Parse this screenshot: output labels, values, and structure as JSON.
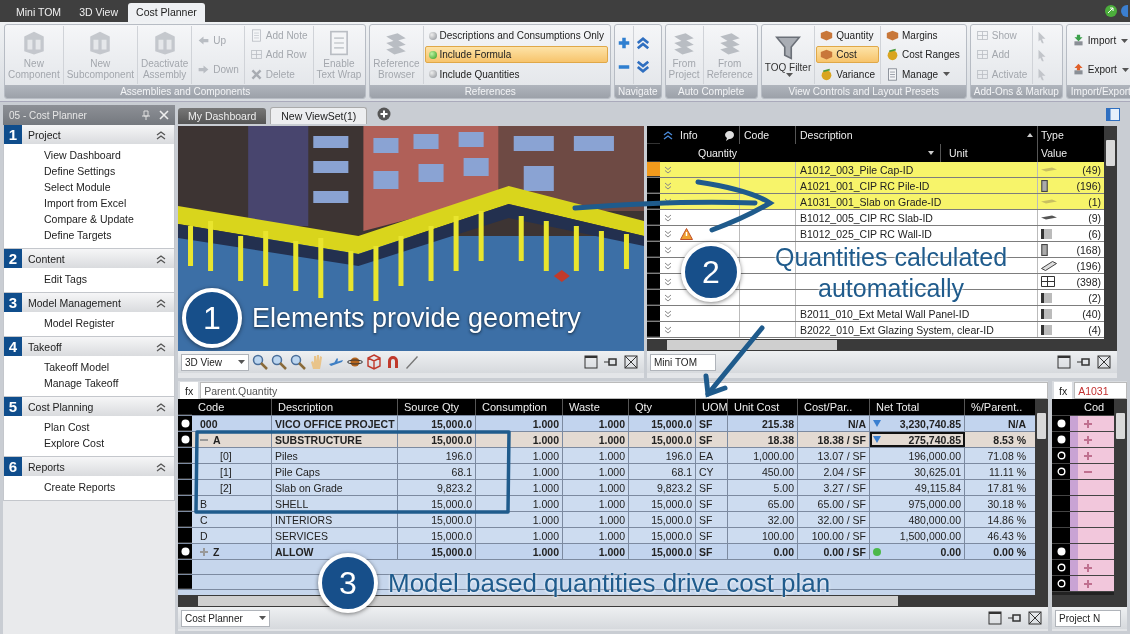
{
  "app_tabs": [
    {
      "label": "Mini TOM",
      "selected": false
    },
    {
      "label": "3D View",
      "selected": false
    },
    {
      "label": "Cost Planner",
      "selected": true
    }
  ],
  "ribbon": {
    "groups": [
      {
        "title": "Assemblies and Components",
        "columns": [
          [
            {
              "label": "New Component",
              "kind": "large",
              "disabled": true
            }
          ],
          [
            {
              "label": "New Subcomponent",
              "kind": "large",
              "disabled": true
            }
          ],
          [
            {
              "label": "Deactivate Assembly",
              "kind": "large",
              "disabled": true
            }
          ],
          [
            {
              "label": "Up",
              "kind": "small",
              "disabled": true
            },
            {
              "label": "Down",
              "kind": "small",
              "disabled": true
            }
          ],
          [
            {
              "label": "Add Note",
              "kind": "small",
              "disabled": true
            },
            {
              "label": "Add Row",
              "kind": "small",
              "disabled": true
            },
            {
              "label": "Delete",
              "kind": "small",
              "disabled": true
            }
          ],
          [
            {
              "label": "Enable Text Wrap",
              "kind": "large",
              "disabled": true
            }
          ]
        ]
      },
      {
        "title": "References",
        "columns": [
          [
            {
              "label": "Reference Browser",
              "kind": "large",
              "disabled": true
            }
          ],
          [
            {
              "label": "Descriptions and Consumptions Only",
              "kind": "radio",
              "selected": false
            },
            {
              "label": "Include Formula",
              "kind": "radio",
              "selected": true
            },
            {
              "label": "Include Quantities",
              "kind": "radio",
              "selected": false
            }
          ]
        ]
      },
      {
        "title": "Navigate",
        "columns": [
          [
            {
              "kind": "icon"
            },
            {
              "kind": "icon"
            }
          ],
          [
            {
              "kind": "icon"
            },
            {
              "kind": "icon"
            }
          ]
        ]
      },
      {
        "title": "Auto Complete",
        "columns": [
          [
            {
              "label": "From Project",
              "kind": "large",
              "disabled": true
            }
          ],
          [
            {
              "label": "From Reference",
              "kind": "large",
              "disabled": true
            }
          ]
        ]
      },
      {
        "title": "View Controls and Layout Presets",
        "columns": [
          [
            {
              "label": "TOQ Filter",
              "kind": "large_dropdown",
              "disabled": false
            }
          ],
          [
            {
              "label": "Quantity",
              "kind": "toggle",
              "selected": false
            },
            {
              "label": "Cost",
              "kind": "toggle",
              "selected": true
            },
            {
              "label": "Variance",
              "kind": "toggle",
              "selected": false
            }
          ],
          [
            {
              "label": "Margins",
              "kind": "small",
              "disabled": false
            },
            {
              "label": "Cost Ranges",
              "kind": "small",
              "disabled": false
            },
            {
              "label": "Manage",
              "kind": "dropdown",
              "disabled": false
            }
          ]
        ]
      },
      {
        "title": "Add-Ons & Markup",
        "columns": [
          [
            {
              "label": "Show",
              "kind": "small",
              "disabled": true
            },
            {
              "label": "Add",
              "kind": "small",
              "disabled": true
            },
            {
              "label": "Activate",
              "kind": "small",
              "disabled": true
            }
          ],
          [
            {
              "kind": "icon",
              "disabled": true
            },
            {
              "kind": "icon",
              "disabled": true
            },
            {
              "kind": "icon",
              "disabled": true
            }
          ]
        ]
      },
      {
        "title": "Import/Export",
        "columns": [
          [
            {
              "label": "Import",
              "kind": "dropdown",
              "disabled": false
            },
            {
              "label": "Export",
              "kind": "dropdown",
              "disabled": false
            }
          ]
        ]
      }
    ]
  },
  "sidebar": {
    "title": "05 - Cost Planner",
    "sections": [
      {
        "number": "1",
        "title": "Project",
        "expanded": true,
        "items": [
          "View Dashboard",
          "Define Settings",
          "Select Module",
          "Import from Excel",
          "Compare & Update",
          "Define Targets"
        ]
      },
      {
        "number": "2",
        "title": "Content",
        "expanded": true,
        "items": [
          "Edit Tags"
        ]
      },
      {
        "number": "3",
        "title": "Model Management",
        "expanded": true,
        "items": [
          "Model Register"
        ]
      },
      {
        "number": "4",
        "title": "Takeoff",
        "expanded": true,
        "items": [
          "Takeoff Model",
          "Manage Takeoff"
        ]
      },
      {
        "number": "5",
        "title": "Cost Planning",
        "expanded": true,
        "items": [
          "Plan Cost",
          "Explore Cost"
        ]
      },
      {
        "number": "6",
        "title": "Reports",
        "expanded": true,
        "items": [
          "Create Reports"
        ]
      }
    ]
  },
  "view_tabs": [
    {
      "label": "My Dashboard",
      "selected": false
    },
    {
      "label": "New ViewSet(1)",
      "selected": true
    }
  ],
  "model_view": {
    "callout": {
      "number": "1",
      "text": "Elements provide geometry"
    },
    "view_select": "3D View"
  },
  "quantity_table": {
    "columns": [
      "Info",
      "Code",
      "Description",
      "Type"
    ],
    "subcolumns": [
      "Quantity",
      "Unit",
      "Value"
    ],
    "rows": [
      {
        "description": "A1012_003_Pile Cap-ID",
        "value": "(49)",
        "highlighted": true,
        "selected": true,
        "warning": false
      },
      {
        "description": "A1021_001_CIP RC Pile-ID",
        "value": "(196)",
        "highlighted": true,
        "selected": false,
        "warning": false
      },
      {
        "description": "A1031_001_Slab on Grade-ID",
        "value": "(1)",
        "highlighted": true,
        "selected": false,
        "warning": false
      },
      {
        "description": "B1012_005_CIP RC Slab-ID",
        "value": "(9)",
        "highlighted": false,
        "selected": false,
        "warning": false
      },
      {
        "description": "B1012_025_CIP RC Wall-ID",
        "value": "(6)",
        "highlighted": false,
        "selected": false,
        "warning": true
      },
      {
        "value": "(168)",
        "highlighted": false,
        "selected": false,
        "warning": false
      },
      {
        "value": "(196)",
        "highlighted": false,
        "selected": false,
        "warning": false
      },
      {
        "value": "(398)",
        "highlighted": false,
        "selected": false,
        "warning": false
      },
      {
        "value": "(2)",
        "highlighted": false,
        "selected": false,
        "warning": false
      },
      {
        "description": "B2011_010_Ext Metal Wall Panel-ID",
        "value": "(40)",
        "highlighted": false,
        "selected": false,
        "warning": false
      },
      {
        "description": "B2022_010_Ext Glazing System, clear-ID",
        "value": "(4)",
        "highlighted": false,
        "selected": false,
        "warning": false
      }
    ],
    "callout": {
      "number": "2",
      "text": "Quantities calculated automatically"
    },
    "view_select": "Mini TOM"
  },
  "cost_table": {
    "formula_label": "fx",
    "formula": "Parent.Quantity",
    "columns": [
      "Code",
      "Description",
      "Source Qty",
      "Consumption",
      "Waste",
      "Qty",
      "UOM",
      "Unit Cost",
      "Cost/Par..",
      "Net Total",
      "%/Parent.."
    ],
    "rows": [
      {
        "code": "000",
        "description": "VICO OFFICE PROJECT",
        "source_qty": "15,000.0",
        "consumption": "1.000",
        "waste": "1.000",
        "qty": "15,000.0",
        "uom": "SF",
        "unit_cost": "215.38",
        "cost_per_parent": "N/A",
        "net_total": "3,230,740.85",
        "pct_parent": "N/A",
        "bullet": true,
        "bold": true,
        "selected": false,
        "down_marker": true,
        "status_dot": false
      },
      {
        "code": "A",
        "description": "SUBSTRUCTURE",
        "source_qty": "15,000.0",
        "consumption": "1.000",
        "waste": "1.000",
        "qty": "15,000.0",
        "uom": "SF",
        "unit_cost": "18.38",
        "cost_per_parent": "18.38 / SF",
        "net_total": "275,740.85",
        "pct_parent": "8.53 %",
        "bullet": true,
        "bold": true,
        "selected": true,
        "down_marker": true,
        "status_dot": false,
        "expanded": true,
        "children": [
          {
            "code": "[0]",
            "description": "Piles",
            "source_qty": "196.0",
            "consumption": "1.000",
            "waste": "1.000",
            "qty": "196.0",
            "uom": "EA",
            "unit_cost": "1,000.00",
            "cost_per_parent": "13.07 / SF",
            "net_total": "196,000.00",
            "pct_parent": "71.08 %",
            "bullet": false,
            "bold": false,
            "selected": false,
            "down_marker": false,
            "status_dot": false
          },
          {
            "code": "[1]",
            "description": "Pile Caps",
            "source_qty": "68.1",
            "consumption": "1.000",
            "waste": "1.000",
            "qty": "68.1",
            "uom": "CY",
            "unit_cost": "450.00",
            "cost_per_parent": "2.04 / SF",
            "net_total": "30,625.01",
            "pct_parent": "11.11 %",
            "bullet": false,
            "bold": false,
            "selected": false,
            "down_marker": false,
            "status_dot": false
          },
          {
            "code": "[2]",
            "description": "Slab on Grade",
            "source_qty": "9,823.2",
            "consumption": "1.000",
            "waste": "1.000",
            "qty": "9,823.2",
            "uom": "SF",
            "unit_cost": "5.00",
            "cost_per_parent": "3.27 / SF",
            "net_total": "49,115.84",
            "pct_parent": "17.81 %",
            "bullet": false,
            "bold": false,
            "selected": false,
            "down_marker": false,
            "status_dot": false
          }
        ]
      },
      {
        "code": "B",
        "description": "SHELL",
        "source_qty": "15,000.0",
        "consumption": "1.000",
        "waste": "1.000",
        "qty": "15,000.0",
        "uom": "SF",
        "unit_cost": "65.00",
        "cost_per_parent": "65.00 / SF",
        "net_total": "975,000.00",
        "pct_parent": "30.18 %",
        "bullet": false,
        "bold": false,
        "selected": false,
        "down_marker": false,
        "status_dot": false
      },
      {
        "code": "C",
        "description": "INTERIORS",
        "source_qty": "15,000.0",
        "consumption": "1.000",
        "waste": "1.000",
        "qty": "15,000.0",
        "uom": "SF",
        "unit_cost": "32.00",
        "cost_per_parent": "32.00 / SF",
        "net_total": "480,000.00",
        "pct_parent": "14.86 %",
        "bullet": false,
        "bold": false,
        "selected": false,
        "down_marker": false,
        "status_dot": false
      },
      {
        "code": "D",
        "description": "SERVICES",
        "source_qty": "15,000.0",
        "consumption": "1.000",
        "waste": "1.000",
        "qty": "15,000.0",
        "uom": "SF",
        "unit_cost": "100.00",
        "cost_per_parent": "100.00 / SF",
        "net_total": "1,500,000.00",
        "pct_parent": "46.43 %",
        "bullet": false,
        "bold": false,
        "selected": false,
        "down_marker": false,
        "status_dot": false
      },
      {
        "code": "Z",
        "description": "ALLOW",
        "source_qty": "15,000.0",
        "consumption": "1.000",
        "waste": "1.000",
        "qty": "15,000.0",
        "uom": "SF",
        "unit_cost": "0.00",
        "cost_per_parent": "0.00 / SF",
        "net_total": "0.00",
        "pct_parent": "0.00 %",
        "bullet": true,
        "bold": true,
        "selected": false,
        "down_marker": false,
        "status_dot": true,
        "expanded": false
      }
    ],
    "callout": {
      "number": "3",
      "text": "Model based quantities drive cost plan"
    },
    "view_select": "Cost Planner"
  },
  "side_table": {
    "formula_label": "fx",
    "formula": "A1031",
    "column": "Cod",
    "rows": [
      {
        "bullet": true,
        "hollow": false,
        "expanded": false
      },
      {
        "bullet": true,
        "hollow": false,
        "expanded": false
      },
      {
        "bullet": false,
        "hollow": true,
        "expanded": false
      },
      {
        "bullet": false,
        "hollow": true,
        "expanded": true
      },
      {
        "bullet": false,
        "hollow": false
      },
      {
        "bullet": false,
        "hollow": false
      },
      {
        "bullet": false,
        "hollow": false
      },
      {
        "bullet": false,
        "hollow": false
      },
      {
        "bullet": true,
        "hollow": false
      },
      {
        "bullet": false,
        "hollow": true,
        "expanded": false
      },
      {
        "bullet": false,
        "hollow": true,
        "expanded": false
      }
    ],
    "view_select": "Project N"
  }
}
